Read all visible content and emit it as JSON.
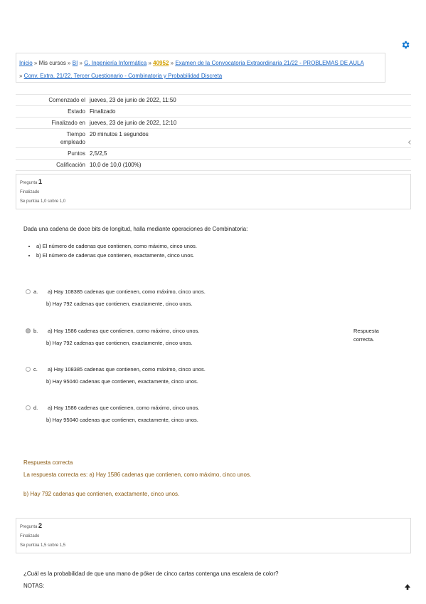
{
  "breadcrumb": {
    "inicio": "Inicio",
    "sep": " » ",
    "mis_cursos": "Mis cursos",
    "bi": "BI",
    "grado": "G. Ingeniería Informática",
    "codigo": "40952",
    "examen": "Examen de la Convocatoria Extraordinaria 21/22 - PROBLEMAS DE AULA",
    "cuestionario": "Conv. Extra. 21/22. Tercer Cuestionario - Combinatoria y Probabilidad Discreta"
  },
  "summary": [
    {
      "key": "Comenzado el",
      "value": "jueves, 23 de junio de 2022, 11:50"
    },
    {
      "key": "Estado",
      "value": "Finalizado"
    },
    {
      "key": "Finalizado en",
      "value": "jueves, 23 de junio de 2022, 12:10"
    },
    {
      "key": "Tiempo empleado",
      "value": "20 minutos 1 segundos"
    },
    {
      "key": "Puntos",
      "value": "2,5/2,5"
    },
    {
      "key": "Calificación",
      "value": "10,0 de 10,0 (100%)"
    }
  ],
  "q1": {
    "label": "Pregunta",
    "number": "1",
    "status": "Finalizado",
    "score": "Se puntúa 1,0 sobre 1,0",
    "text": "Dada una cadena de doce bits de longitud, halla mediante operaciones de Combinatoria:",
    "items": [
      "a) El número de cadenas que contienen, como máximo, cinco unos.",
      "b) El número de cadenas que contienen, exactamente, cinco unos."
    ],
    "options": [
      {
        "letter": "a.",
        "line1": "a) Hay 108385 cadenas que contienen, como máximo, cinco unos.",
        "line2": "b) Hay 792 cadenas que contienen, exactamente, cinco unos."
      },
      {
        "letter": "b.",
        "line1": "a) Hay 1586 cadenas que contienen, como máximo, cinco unos.",
        "line2": "b) Hay 792 cadenas que contienen, exactamente, cinco unos."
      },
      {
        "letter": "c.",
        "line1": "a) Hay 108385 cadenas que contienen, como máximo, cinco unos.",
        "line2": "b) Hay 95040 cadenas que contienen, exactamente, cinco unos."
      },
      {
        "letter": "d.",
        "line1": "a) Hay 1586 cadenas que contienen, como máximo, cinco unos.",
        "line2": "b) Hay 95040 cadenas que contienen, exactamente, cinco unos."
      }
    ],
    "side_feedback": "Respuesta correcta.",
    "feedback_title": "Respuesta correcta",
    "feedback_line1": "La respuesta correcta es: a) Hay 1586 cadenas que contienen, como máximo, cinco unos.",
    "feedback_line2": "b) Hay 792 cadenas que contienen, exactamente, cinco unos."
  },
  "q2": {
    "label": "Pregunta",
    "number": "2",
    "status": "Finalizado",
    "score": "Se puntúa 1,5 sobre 1,5",
    "text": "¿Cuál es la probabilidad de que una mano de póker de cinco cartas contenga una escalera de color?",
    "notes": "NOTAS:"
  },
  "icons": {
    "settings": "gear-icon",
    "drawer": "chevron-left-icon",
    "top": "arrow-up-icon"
  },
  "colors": {
    "link": "#1a64c4",
    "accent": "#1177d1",
    "feedback": "#8a5a12"
  }
}
